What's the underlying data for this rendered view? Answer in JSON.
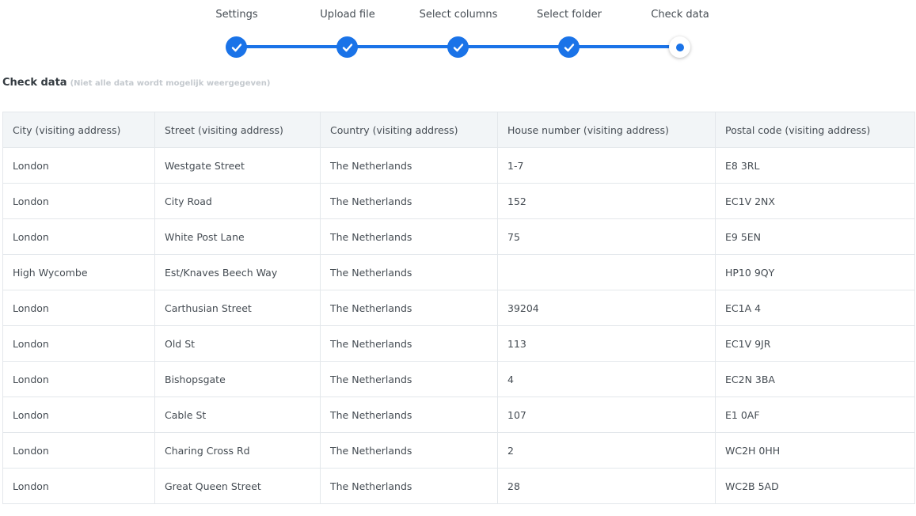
{
  "stepper": {
    "steps": [
      {
        "label": "Settings",
        "state": "done"
      },
      {
        "label": "Upload file",
        "state": "done"
      },
      {
        "label": "Select columns",
        "state": "done"
      },
      {
        "label": "Select folder",
        "state": "done"
      },
      {
        "label": "Check data",
        "state": "current"
      }
    ],
    "accent_color": "#1a73e8"
  },
  "section": {
    "title": "Check data",
    "note": "(Niet alle data wordt mogelijk weergegeven)"
  },
  "table": {
    "columns": [
      "City (visiting address)",
      "Street (visiting address)",
      "Country (visiting address)",
      "House number (visiting address)",
      "Postal code (visiting address)"
    ],
    "rows": [
      [
        "London",
        "Westgate Street",
        "The Netherlands",
        "1-7",
        "E8 3RL"
      ],
      [
        "London",
        "City Road",
        "The Netherlands",
        "152",
        "EC1V 2NX"
      ],
      [
        "London",
        "White Post Lane",
        "The Netherlands",
        "75",
        "E9 5EN"
      ],
      [
        "High Wycombe",
        "Est/Knaves Beech Way",
        "The Netherlands",
        "",
        "HP10 9QY"
      ],
      [
        "London",
        "Carthusian Street",
        "The Netherlands",
        "39204",
        "EC1A 4"
      ],
      [
        "London",
        "Old St",
        "The Netherlands",
        "113",
        "EC1V 9JR"
      ],
      [
        "London",
        "Bishopsgate",
        "The Netherlands",
        "4",
        "EC2N 3BA"
      ],
      [
        "London",
        "Cable St",
        "The Netherlands",
        "107",
        "E1 0AF"
      ],
      [
        "London",
        "Charing Cross Rd",
        "The Netherlands",
        "2",
        "WC2H 0HH"
      ],
      [
        "London",
        "Great Queen Street",
        "The Netherlands",
        "28",
        "WC2B 5AD"
      ]
    ]
  }
}
